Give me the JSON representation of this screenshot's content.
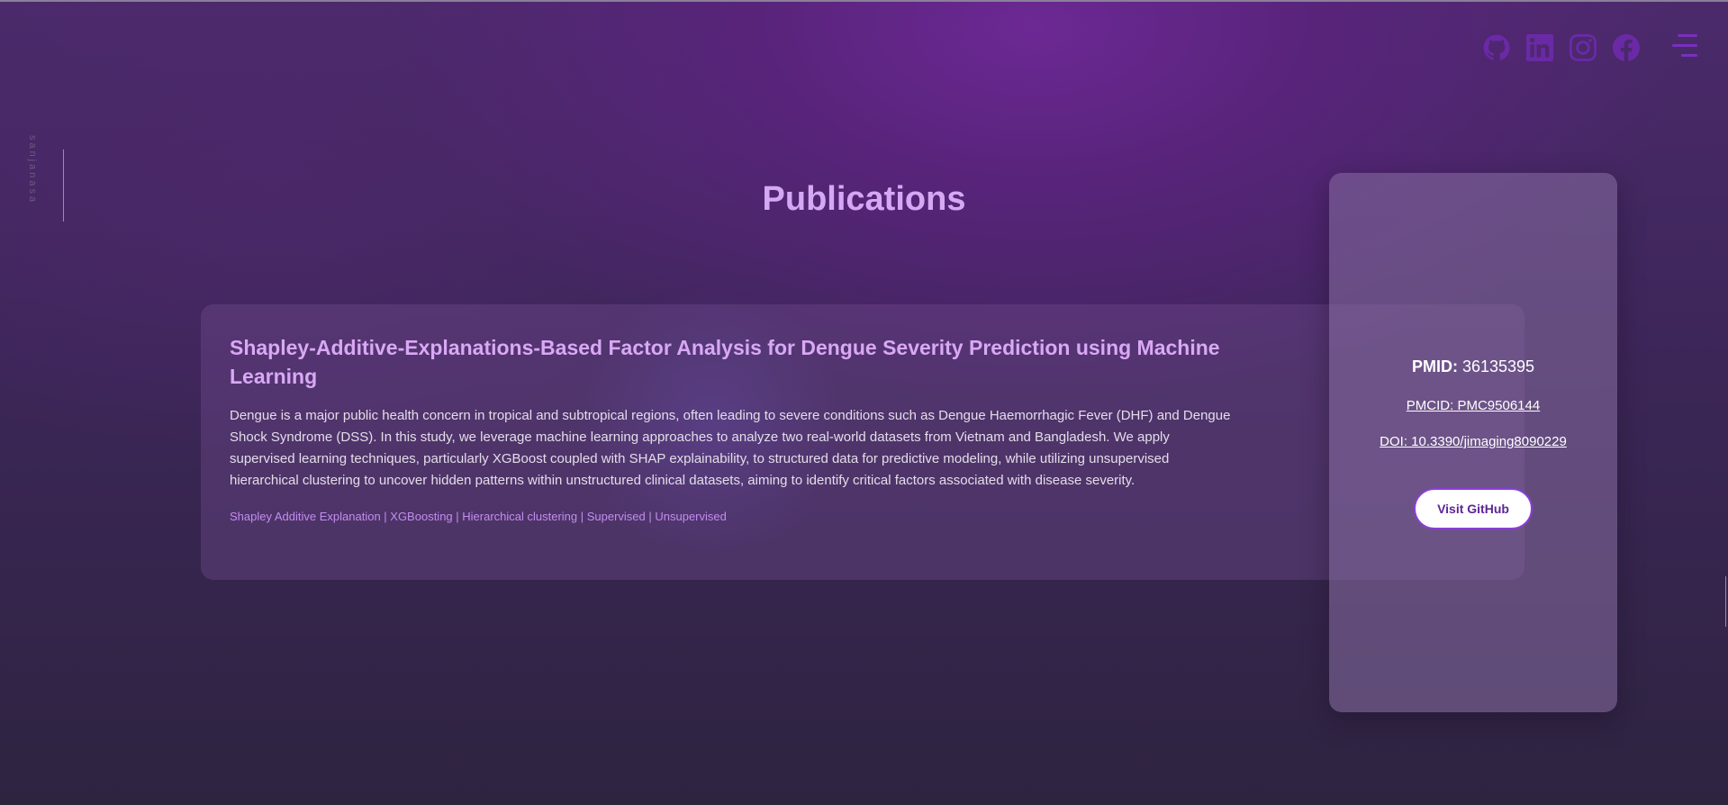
{
  "brand": {
    "text": "sanjanasa"
  },
  "header": {
    "socials": [
      {
        "name": "github",
        "icon": "github-icon"
      },
      {
        "name": "linkedin",
        "icon": "linkedin-icon"
      },
      {
        "name": "instagram",
        "icon": "instagram-icon"
      },
      {
        "name": "facebook",
        "icon": "facebook-icon"
      }
    ],
    "menu_icon": "menu-icon"
  },
  "page": {
    "title": "Publications"
  },
  "publication": {
    "title": "Shapley-Additive-Explanations-Based Factor Analysis for Dengue Severity Prediction using Machine Learning",
    "description": "Dengue is a major public health concern in tropical and subtropical regions, often leading to severe conditions such as Dengue Haemorrhagic Fever (DHF) and Dengue Shock Syndrome (DSS). In this study, we leverage machine learning approaches to analyze two real-world datasets from Vietnam and Bangladesh. We apply supervised learning techniques, particularly XGBoost coupled with SHAP explainability, to structured data for predictive modeling, while utilizing unsupervised hierarchical clustering to uncover hidden patterns within unstructured clinical datasets, aiming to identify critical factors associated with disease severity.",
    "tags": "Shapley Additive Explanation | XGBoosting | Hierarchical clustering | Supervised | Unsupervised"
  },
  "panel": {
    "pmid_label": "PMID:",
    "pmid_value": "36135395",
    "pmcid": "PMCID: PMC9506144",
    "doi": "DOI: 10.3390/jimaging8090229",
    "github_button": "Visit GitHub"
  },
  "colors": {
    "accent": "#d5a8f3",
    "icon": "#6a2aa6",
    "tag": "#c48cf0",
    "button_text": "#5e2597"
  }
}
